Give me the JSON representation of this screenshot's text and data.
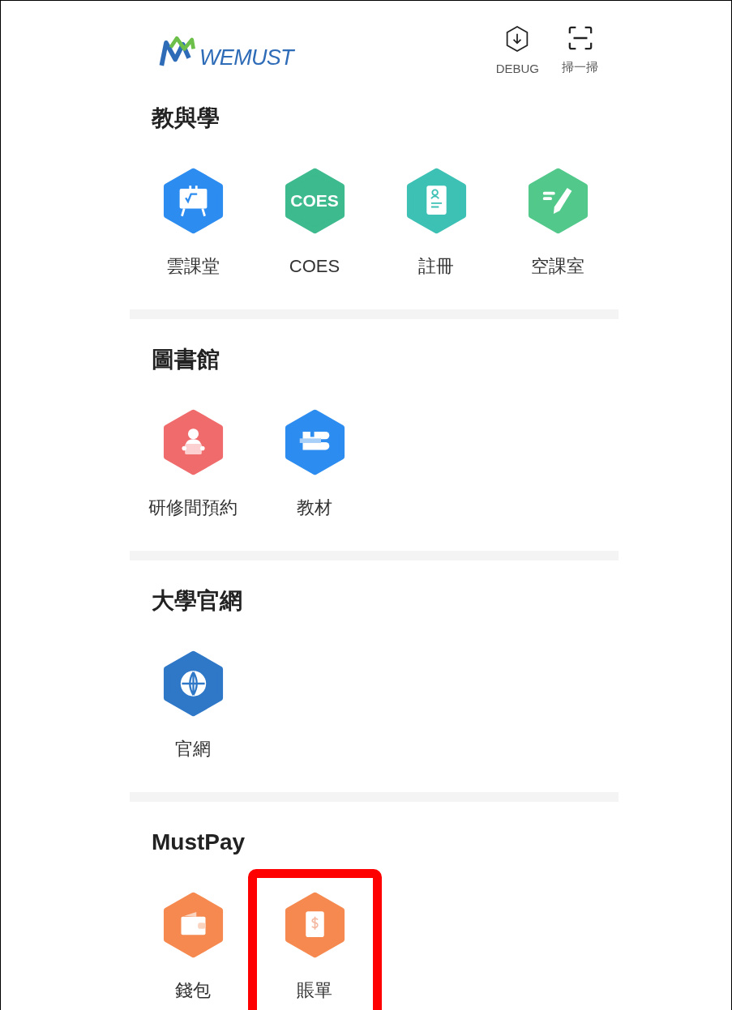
{
  "header": {
    "logo_text": "WEMUST",
    "actions": [
      {
        "kind": "download",
        "label": "DEBUG"
      },
      {
        "kind": "scan",
        "label": "掃一掃"
      }
    ]
  },
  "sections": [
    {
      "title": "教與學",
      "items": [
        {
          "label": "雲課堂",
          "kind": "board",
          "color": "#2d8cf0",
          "highlighted": false
        },
        {
          "label": "COES",
          "kind": "text",
          "icon_text": "COES",
          "color": "#3dba8e",
          "highlighted": false
        },
        {
          "label": "註冊",
          "kind": "id-card",
          "color": "#3cc1b4",
          "highlighted": false
        },
        {
          "label": "空課室",
          "kind": "pencil",
          "color": "#52c98a",
          "highlighted": false
        }
      ]
    },
    {
      "title": "圖書館",
      "items": [
        {
          "label": "研修間預約",
          "kind": "reader",
          "color": "#f06b6b",
          "highlighted": false
        },
        {
          "label": "教材",
          "kind": "books",
          "color": "#2d8cf0",
          "highlighted": false
        }
      ]
    },
    {
      "title": "大學官網",
      "items": [
        {
          "label": "官網",
          "kind": "globe",
          "color": "#2f78c8",
          "highlighted": false
        }
      ]
    },
    {
      "title": "MustPay",
      "items": [
        {
          "label": "錢包",
          "kind": "wallet",
          "color": "#f5894f",
          "highlighted": false
        },
        {
          "label": "賬單",
          "kind": "bill",
          "color": "#f5894f",
          "highlighted": true
        }
      ]
    }
  ]
}
